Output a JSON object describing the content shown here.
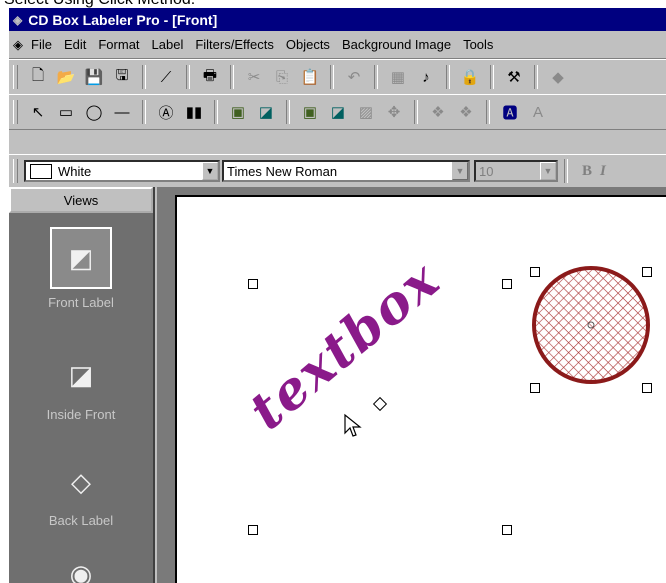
{
  "caption": "Select Using Click Method:",
  "window": {
    "title": "CD Box Labeler Pro - [Front]"
  },
  "menu": [
    {
      "label": "File"
    },
    {
      "label": "Edit"
    },
    {
      "label": "Format"
    },
    {
      "label": "Label"
    },
    {
      "label": "Filters/Effects"
    },
    {
      "label": "Objects"
    },
    {
      "label": "Background Image"
    },
    {
      "label": "Tools"
    }
  ],
  "toolbar1": [
    "new-icon",
    "open-icon",
    "save-icon",
    "save-all-icon",
    "wand-icon",
    "print-icon",
    "cut-icon",
    "copy-icon",
    "paste-icon",
    "undo-icon",
    "table-icon",
    "audio-icon",
    "lock-icon",
    "tools-icon"
  ],
  "toolbar2": [
    "select-arrow-icon",
    "rectangle-icon",
    "ellipse-icon",
    "line-icon",
    "text-tool-icon",
    "barcode-icon",
    "image-icon",
    "picture-icon",
    "image2-icon",
    "picture2-icon",
    "fill-icon",
    "move-icon",
    "effect-icon",
    "effect2-icon",
    "text-edit-icon"
  ],
  "format": {
    "color_value": "White",
    "color_swatch": "#ffffff",
    "font_value": "Times New Roman",
    "size_value": "10",
    "bold_label": "B",
    "italic_label": "I"
  },
  "views": {
    "header": "Views",
    "items": [
      {
        "label": "Front Label",
        "icon": "front-label-icon"
      },
      {
        "label": "Inside Front",
        "icon": "inside-front-icon"
      },
      {
        "label": "Back Label",
        "icon": "back-label-icon"
      },
      {
        "label": "",
        "icon": "cd-disc-icon"
      }
    ]
  },
  "canvas": {
    "text_object": "textbox",
    "colors": {
      "text": "#8a1a8a",
      "circle_stroke": "#8b1a1a",
      "circle_pattern": "#a33"
    }
  }
}
